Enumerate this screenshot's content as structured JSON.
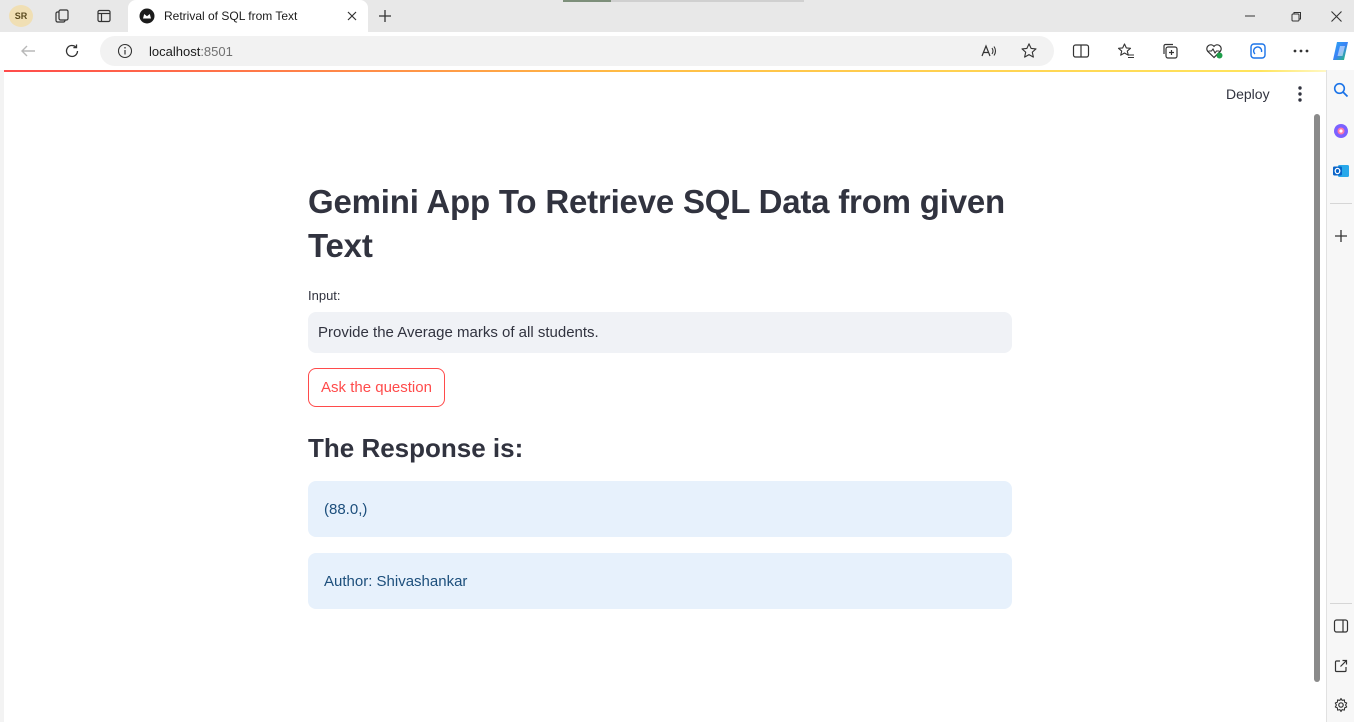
{
  "browser": {
    "profile_initials": "SR",
    "tab_title": "Retrival of SQL from Text",
    "address_host": "localhost",
    "address_port": ":8501",
    "icons": {
      "workspaces": "workspaces-icon",
      "tab_actions": "tab-actions-icon",
      "back": "back-arrow-icon",
      "refresh": "refresh-icon",
      "site_info": "info-icon",
      "read_aloud": "read-aloud-icon",
      "favorite": "star-icon",
      "split_screen": "split-screen-icon",
      "favorites": "favorites-icon",
      "collections": "collections-icon",
      "browser_essentials": "heart-pulse-icon",
      "performance": "performance-icon",
      "more": "more-dots-icon",
      "copilot": "copilot-icon"
    }
  },
  "edge_sidebar": {
    "icons": [
      "search-icon",
      "copilot-icon",
      "outlook-icon",
      "add-icon",
      "sidebar-toggle-icon",
      "external-link-icon",
      "settings-icon"
    ]
  },
  "app": {
    "deploy_label": "Deploy",
    "title": "Gemini App To Retrieve SQL Data from given Text",
    "input_label": "Input:",
    "input_value": "Provide the Average marks of all students.",
    "button_label": "Ask the question",
    "response_heading": "The Response is:",
    "response_value": "(88.0,)",
    "author_text": "Author: Shivashankar"
  },
  "colors": {
    "accent": "#ff4b4b",
    "info_background": "#e7f1fc",
    "info_text": "#1d4f7c",
    "heading_text": "#31333f"
  }
}
